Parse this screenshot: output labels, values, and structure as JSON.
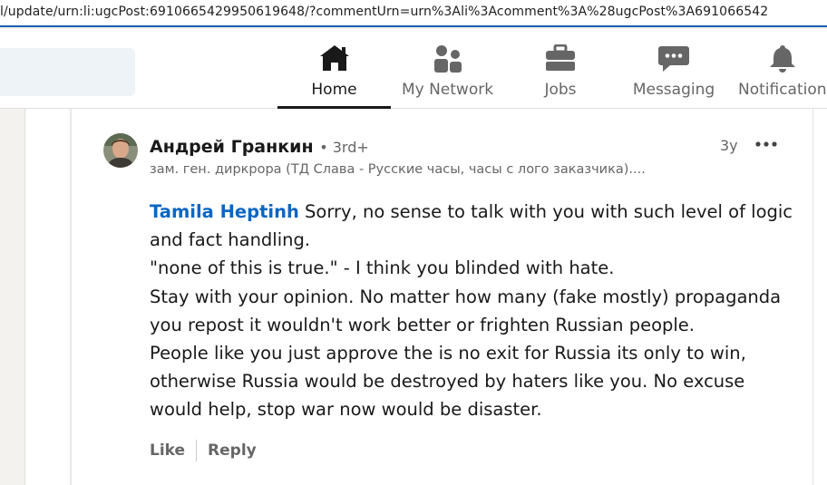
{
  "browser": {
    "url": "l/update/urn:li:ugcPost:6910665429950619648/?commentUrn=urn%3Ali%3Acomment%3A%28ugcPost%3A691066542"
  },
  "nav": {
    "items": [
      {
        "label": "Home",
        "icon": "home-icon",
        "active": true
      },
      {
        "label": "My Network",
        "icon": "my-network-icon",
        "active": false
      },
      {
        "label": "Jobs",
        "icon": "briefcase-icon",
        "active": false
      },
      {
        "label": "Messaging",
        "icon": "message-icon",
        "active": false
      },
      {
        "label": "Notification",
        "icon": "bell-icon",
        "active": false
      }
    ],
    "active_color": "#191919",
    "inactive_color": "#666666"
  },
  "comment": {
    "author": "Андрей Гранкин",
    "degree": "• 3rd+",
    "headline": "зам. ген. диркрора (ТД Слава - Русские часы, часы с лого заказчика)....",
    "time": "3y",
    "mention": "Tamila Heptinh",
    "lines": [
      " Sorry, no sense to talk with you with such level of logic",
      "and fact handling.",
      "\"none of this is true.\" - I think you blinded with hate.",
      "Stay with your opinion. No matter how many (fake mostly) propaganda",
      "you repost it wouldn't work better or frighten Russian people.",
      "People like you just approve the is no exit for Russia its only to win,",
      "otherwise Russia would be destroyed by haters like you. No excuse",
      "would help, stop war now would be disaster."
    ],
    "actions": {
      "like": "Like",
      "reply": "Reply"
    },
    "mention_color": "#0a66c2"
  }
}
